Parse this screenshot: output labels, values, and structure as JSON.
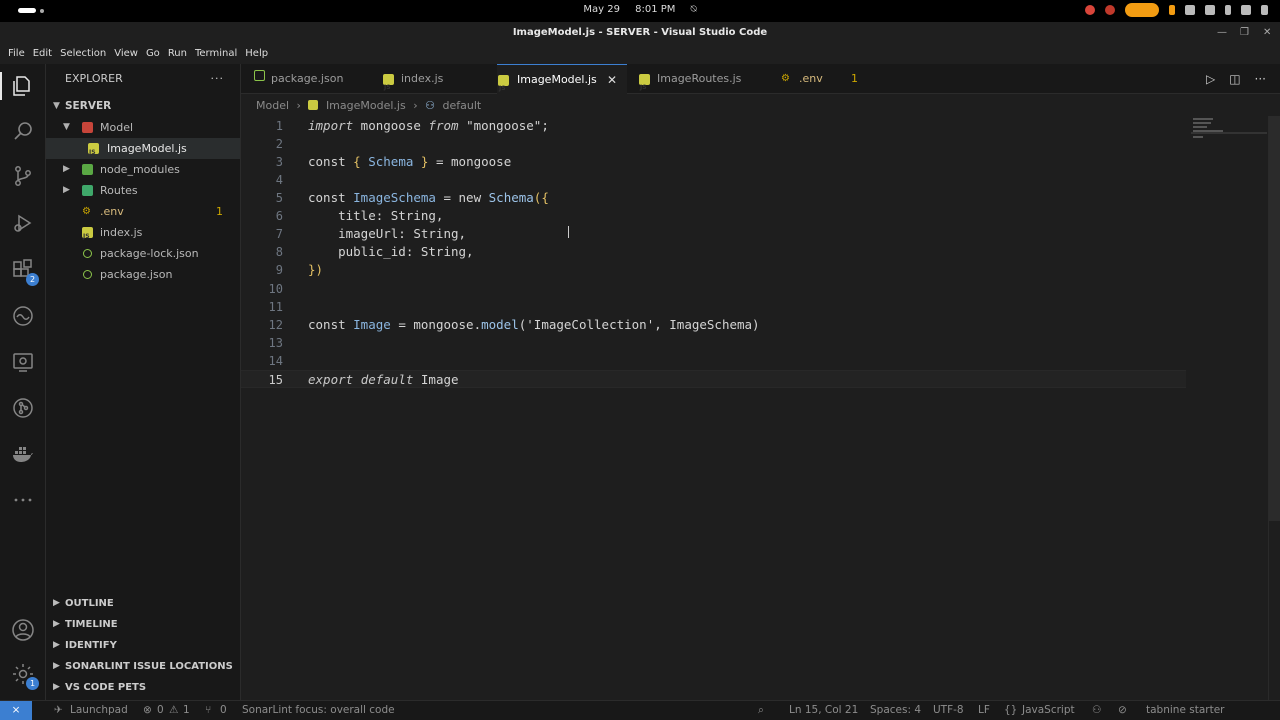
{
  "os": {
    "date": "May 29",
    "time": "8:01 PM"
  },
  "window": {
    "title": "ImageModel.js - SERVER - Visual Studio Code"
  },
  "menu": [
    "File",
    "Edit",
    "Selection",
    "View",
    "Go",
    "Run",
    "Terminal",
    "Help"
  ],
  "activity": {
    "extensions_badge": "2",
    "settings_badge": "1"
  },
  "sidebar": {
    "title": "EXPLORER",
    "more": "···",
    "root": "SERVER",
    "tree": [
      {
        "label": "Model",
        "type": "folder",
        "open": true
      },
      {
        "label": "ImageModel.js",
        "type": "js"
      },
      {
        "label": "node_modules",
        "type": "folder"
      },
      {
        "label": "Routes",
        "type": "folder"
      },
      {
        "label": ".env",
        "type": "env",
        "count": "1"
      },
      {
        "label": "index.js",
        "type": "js"
      },
      {
        "label": "package-lock.json",
        "type": "json"
      },
      {
        "label": "package.json",
        "type": "json"
      }
    ],
    "sections": [
      "OUTLINE",
      "TIMELINE",
      "IDENTIFY",
      "SONARLINT ISSUE LOCATIONS",
      "VS CODE PETS"
    ]
  },
  "tabs": [
    {
      "label": "package.json",
      "icon": "json-icon"
    },
    {
      "label": "index.js",
      "icon": "js-icon"
    },
    {
      "label": "ImageModel.js",
      "icon": "js-icon",
      "active": true
    },
    {
      "label": "ImageRoutes.js",
      "icon": "js-icon"
    },
    {
      "label": ".env",
      "icon": "env-icon",
      "count": "1"
    }
  ],
  "breadcrumb": {
    "folder": "Model",
    "file": "ImageModel.js",
    "symbol": "default"
  },
  "editor": {
    "line_numbers": [
      "1",
      "2",
      "3",
      "4",
      "5",
      "6",
      "7",
      "8",
      "9",
      "10",
      "11",
      "12",
      "13",
      "14",
      "15"
    ],
    "current_line": "15"
  },
  "status": {
    "launchpad": "Launchpad",
    "errors": "0",
    "warnings": "1",
    "ports": "0",
    "sonarlint": "SonarLint focus: overall code",
    "position": "Ln 15, Col 21",
    "spaces": "Spaces: 4",
    "encoding": "UTF-8",
    "eol": "LF",
    "language": "JavaScript",
    "tabnine": "tabnine starter"
  }
}
